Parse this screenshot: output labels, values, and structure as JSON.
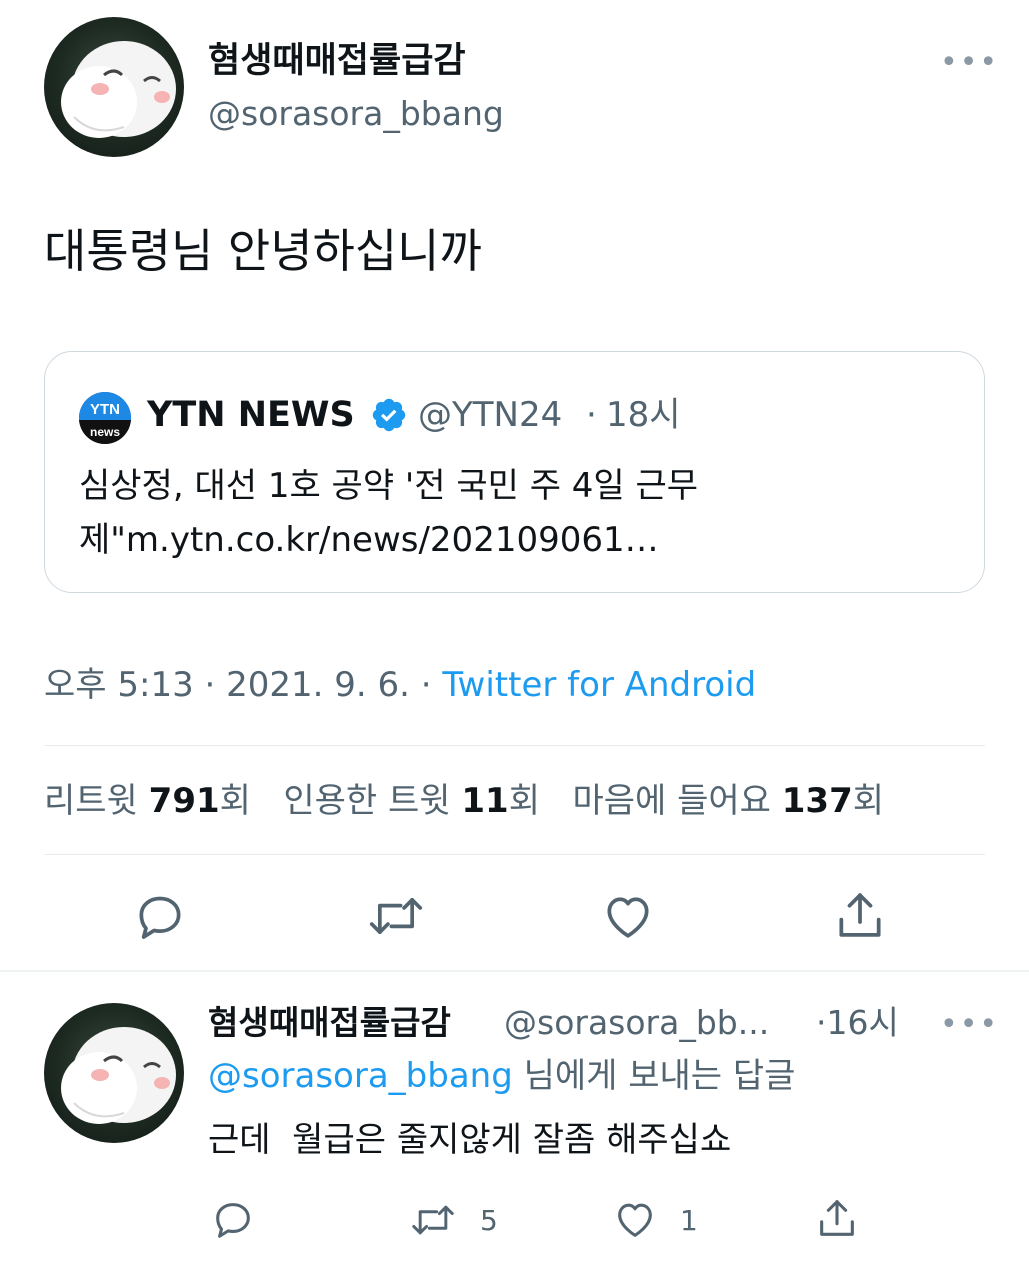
{
  "main_tweet": {
    "author_name": "혐생때매접률급감",
    "author_handle": "@sorasora_bbang",
    "text": "대통령님 안녕하십니까",
    "quoted": {
      "logo_text_top": "YTN",
      "logo_text_bottom": "news",
      "name": "YTN NEWS",
      "handle": "@YTN24",
      "time": "18시",
      "text_line1": "심상정, 대선 1호 공약 '전 국민 주 4일 근무",
      "text_line2": "제\"m.ytn.co.kr/news/202109061…"
    },
    "timestamp": "오후 5:13 · 2021. 9. 6. · ",
    "source": "Twitter for Android",
    "stats": {
      "retweet_label": "리트윗",
      "retweet_count": "791",
      "quote_label": "인용한 트윗",
      "quote_count": "11",
      "like_label": "마음에 들어요",
      "like_count": "137",
      "unit": "회"
    }
  },
  "reply": {
    "author_name": "혐생때매접률급감",
    "author_handle": "@sorasora_bb...",
    "time": "·16시",
    "replying_to_handle": "@sorasora_bbang",
    "replying_to_suffix": " 님에게 보내는 답글",
    "text": "근데  월급은 줄지않게 잘좀 해주십쇼",
    "retweet_count": "5",
    "like_count": "1"
  },
  "icons": {
    "more": "more-icon",
    "reply": "reply-icon",
    "retweet": "retweet-icon",
    "like": "heart-icon",
    "share": "share-icon",
    "verified": "verified-icon"
  },
  "colors": {
    "link": "#1d9bf0",
    "secondary_text": "#536471",
    "verified": "#1d9bf0",
    "divider": "#e6ecf0"
  }
}
